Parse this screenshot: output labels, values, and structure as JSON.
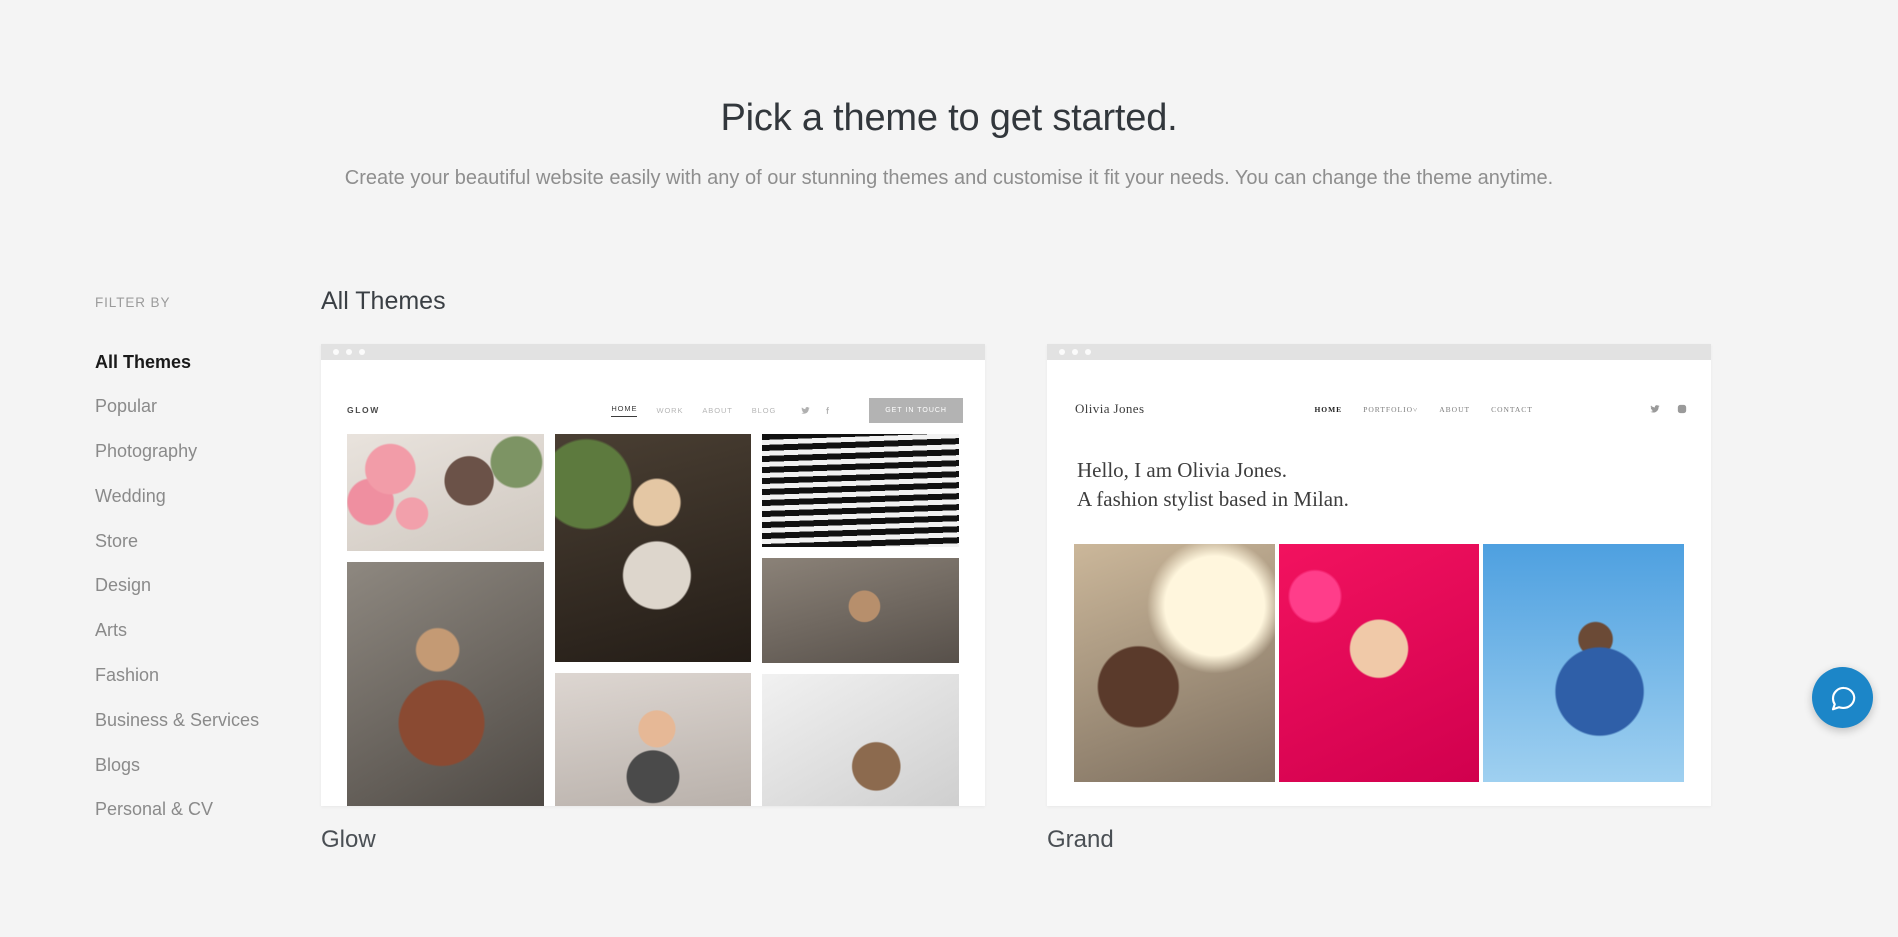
{
  "hero": {
    "title": "Pick a theme to get started.",
    "subtitle": "Create your beautiful website easily with any of our stunning themes and customise it fit your needs. You can change the theme anytime."
  },
  "sidebar": {
    "label": "FILTER BY",
    "items": [
      {
        "label": "All Themes",
        "active": true
      },
      {
        "label": "Popular",
        "active": false
      },
      {
        "label": "Photography",
        "active": false
      },
      {
        "label": "Wedding",
        "active": false
      },
      {
        "label": "Store",
        "active": false
      },
      {
        "label": "Design",
        "active": false
      },
      {
        "label": "Arts",
        "active": false
      },
      {
        "label": "Fashion",
        "active": false
      },
      {
        "label": "Business & Services",
        "active": false
      },
      {
        "label": "Blogs",
        "active": false
      },
      {
        "label": "Personal & CV",
        "active": false
      }
    ]
  },
  "main": {
    "section_title": "All Themes",
    "themes": [
      {
        "name": "Glow",
        "preview": {
          "logo": "GLOW",
          "nav": [
            "HOME",
            "WORK",
            "ABOUT",
            "BLOG"
          ],
          "active_nav": "HOME",
          "social": [
            "twitter-icon",
            "facebook-icon"
          ],
          "cta": "GET IN TOUCH"
        }
      },
      {
        "name": "Grand",
        "preview": {
          "logo": "Olivia Jones",
          "nav": [
            "HOME",
            "PORTFOLIO",
            "ABOUT",
            "CONTACT"
          ],
          "active_nav": "HOME",
          "portfolio_caret": "˅",
          "social": [
            "twitter-icon",
            "instagram-icon"
          ],
          "hero_line1": "Hello, I am Olivia Jones.",
          "hero_line2": "A fashion stylist based in Milan."
        }
      }
    ]
  },
  "chat": {
    "icon": "chat-bubble-icon",
    "color": "#1c86c8"
  }
}
